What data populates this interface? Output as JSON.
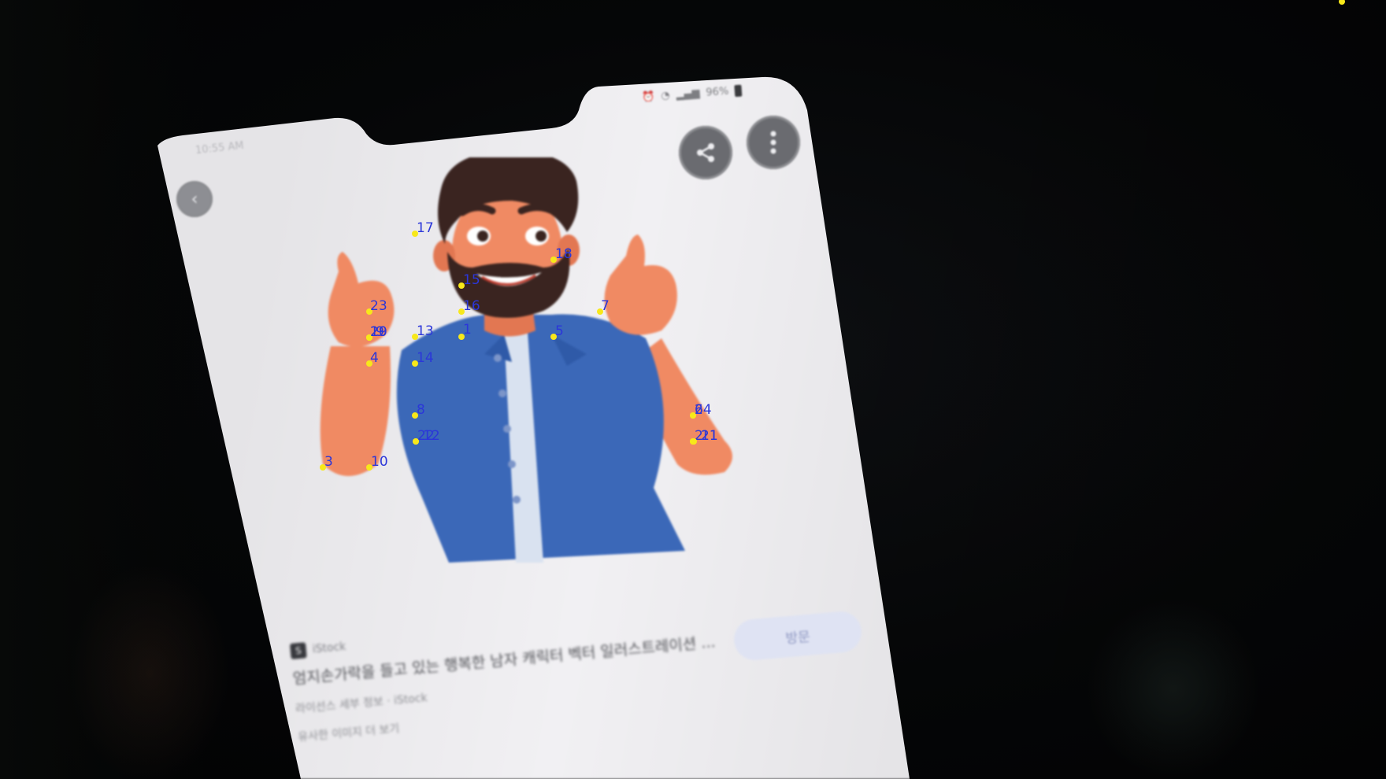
{
  "phone": {
    "status_time": "10:55 AM",
    "status_battery": "96%",
    "back_icon": "back-circle-icon",
    "share_icon": "share-icon",
    "more_icon": "more-vertical-icon"
  },
  "result": {
    "source": "iStock",
    "title": "엄지손가락을 들고 있는 행복한 남자 캐릭터 벡터 일러스트레이션 ...",
    "meta_line1": "라이선스 세부 정보 · iStock",
    "meta_line2": "유사한 이미지 더 보기",
    "save_label": "방문"
  },
  "keypoints": [
    {
      "id": "1"
    },
    {
      "id": "2"
    },
    {
      "id": "3"
    },
    {
      "id": "4"
    },
    {
      "id": "5"
    },
    {
      "id": "6"
    },
    {
      "id": "7"
    },
    {
      "id": "8"
    },
    {
      "id": "9"
    },
    {
      "id": "10"
    },
    {
      "id": "11"
    },
    {
      "id": "12"
    },
    {
      "id": "13"
    },
    {
      "id": "14"
    },
    {
      "id": "15"
    },
    {
      "id": "16"
    },
    {
      "id": "17"
    },
    {
      "id": "18"
    },
    {
      "id": "19"
    },
    {
      "id": "20"
    },
    {
      "id": "21"
    },
    {
      "id": "22"
    },
    {
      "id": "23"
    },
    {
      "id": "24"
    }
  ],
  "colors": {
    "keypoint": "#f7e81a",
    "keypoint_label": "#2b36d9",
    "skin": "#f08a63",
    "shirt": "#3b68b8",
    "beard": "#3a2420"
  }
}
